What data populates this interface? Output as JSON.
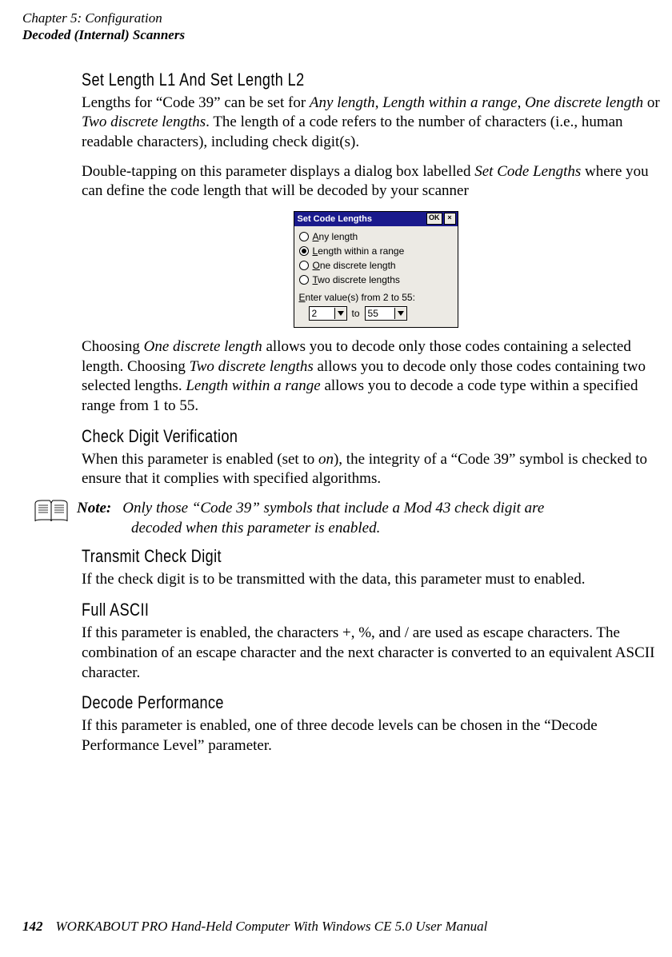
{
  "header": {
    "chapter_line": "Chapter 5: Configuration",
    "section_line": "Decoded (Internal) Scanners"
  },
  "sec1": {
    "title": "Set Length L1 And Set Length L2",
    "p1_pre": "Lengths for “Code 39” can be set for ",
    "p1_i1": "Any length",
    "p1_c1": ", ",
    "p1_i2": "Length within a range",
    "p1_c2": ", ",
    "p1_i3": "One discrete length",
    "p1_c3": " or ",
    "p1_i4": "Two discrete lengths",
    "p1_post": ". The length of a code refers to the number of characters (i.e., human readable characters), including check digit(s).",
    "p2_pre": "Double-tapping on this parameter displays a dialog box labelled ",
    "p2_i1": "Set Code Lengths",
    "p2_post": " where you can define the code length that will be decoded by your scanner"
  },
  "dialog": {
    "title": "Set Code Lengths",
    "ok": "OK",
    "close": "×",
    "opt_any_pre": "A",
    "opt_any": "ny length",
    "opt_range_pre": "L",
    "opt_range": "ength within a range",
    "opt_one_pre": "O",
    "opt_one": "ne discrete length",
    "opt_two_pre": "T",
    "opt_two": "wo discrete lengths",
    "enter_pre": "E",
    "enter": "nter value(s) from 2 to 55:",
    "from_val": "2",
    "to_label": "to",
    "to_val": "55",
    "selected": "Length within a range"
  },
  "sec1b": {
    "p3_pre": "Choosing ",
    "p3_i1": "One discrete length",
    "p3_mid1": " allows you to decode only those codes containing a selected length. Choosing ",
    "p3_i2": "Two discrete lengths",
    "p3_mid2": " allows you to decode only those codes containing two selected lengths. ",
    "p3_i3": "Length within a range",
    "p3_post": " allows you to decode a code type within a specified range from 1 to 55."
  },
  "sec2": {
    "title": "Check Digit Verification",
    "p_pre": "When this parameter is enabled (set to ",
    "p_i1": "on",
    "p_post": "), the integrity of a “Code 39” symbol is checked to ensure that it complies with specified algorithms."
  },
  "note": {
    "label": "Note:",
    "line1": "Only those “Code 39” symbols that include a Mod 43 check digit are",
    "line2": "decoded when this parameter is enabled."
  },
  "sec3": {
    "title": "Transmit Check Digit",
    "p": "If the check digit is to be transmitted with the data, this parameter must to enabled."
  },
  "sec4": {
    "title": "Full ASCII",
    "p": "If this parameter is enabled, the characters +, %, and / are used as escape characters. The combination of an escape character and the next character is converted to an equivalent ASCII character."
  },
  "sec5": {
    "title": "Decode Performance",
    "p": "If this parameter is enabled, one of three decode levels can be chosen in the “Decode Performance Level” parameter."
  },
  "footer": {
    "page_num": "142",
    "text": "WORKABOUT PRO Hand-Held Computer With Windows CE 5.0 User Manual"
  }
}
